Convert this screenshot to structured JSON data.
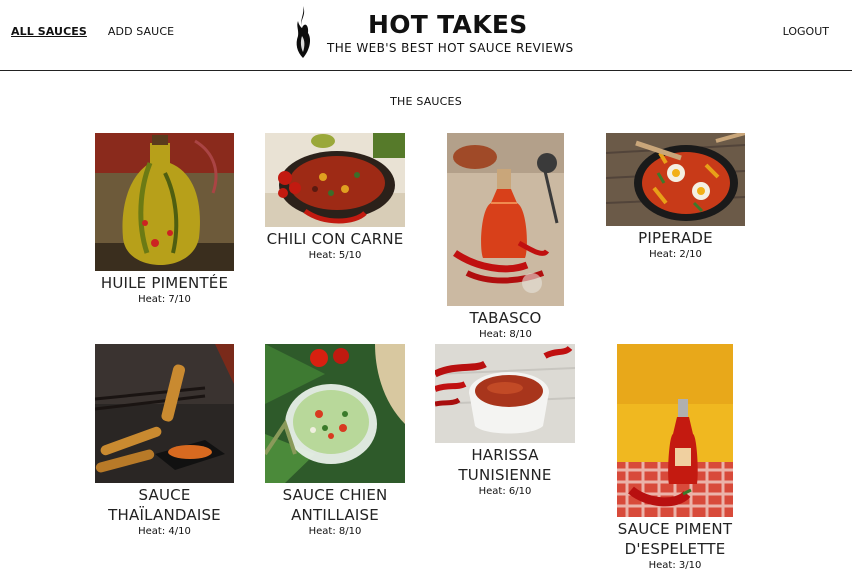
{
  "nav": {
    "all_sauces": "ALL SAUCES",
    "add_sauce": "ADD SAUCE",
    "logout": "LOGOUT"
  },
  "brand": {
    "title": "HOT TAKES",
    "subtitle": "THE WEB'S BEST HOT SAUCE REVIEWS"
  },
  "main": {
    "section_title": "THE SAUCES"
  },
  "sauces": [
    {
      "name_lines": [
        "HUILE PIMENTÉE"
      ],
      "heat": "Heat: 7/10",
      "image": "chili-oil-bottle"
    },
    {
      "name_lines": [
        "CHILI CON CARNE"
      ],
      "heat": "Heat: 5/10",
      "image": "chili-con-carne-pan"
    },
    {
      "name_lines": [
        "TABASCO"
      ],
      "heat": "Heat: 8/10",
      "image": "tabasco-bottle"
    },
    {
      "name_lines": [
        "PIPERADE"
      ],
      "heat": "Heat: 2/10",
      "image": "piperade-pan"
    },
    {
      "name_lines": [
        "SAUCE",
        "THAÏLANDAISE"
      ],
      "heat": "Heat: 4/10",
      "image": "thai-sauce-dip"
    },
    {
      "name_lines": [
        "SAUCE CHIEN",
        "ANTILLAISE"
      ],
      "heat": "Heat: 8/10",
      "image": "sauce-chien-bowl"
    },
    {
      "name_lines": [
        "HARISSA",
        "TUNISIENNE"
      ],
      "heat": "Heat: 6/10",
      "image": "harissa-bowl"
    },
    {
      "name_lines": [
        "SAUCE PIMENT",
        "D'ESPELETTE"
      ],
      "heat": "Heat: 3/10",
      "image": "espelette-bottle"
    }
  ]
}
